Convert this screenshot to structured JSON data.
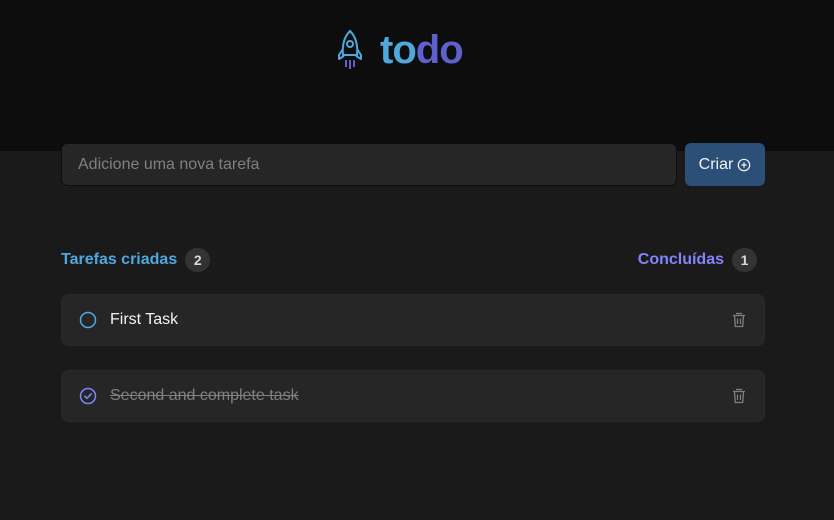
{
  "app": {
    "logo_part1": "to",
    "logo_part2": "do",
    "colors": {
      "brand_blue": "#4ea8de",
      "brand_purple": "#5e60ce",
      "purple_light": "#8284fa",
      "button": "#2b4f76"
    }
  },
  "new_task": {
    "placeholder": "Adicione uma nova tarefa",
    "value": "",
    "create_label": "Criar",
    "create_icon": "plus-circle-icon"
  },
  "counters": {
    "created_label": "Tarefas criadas",
    "created_count": "2",
    "done_label": "Concluídas",
    "done_count": "1"
  },
  "tasks": [
    {
      "text": "First Task",
      "completed": false,
      "check_icon": "circle-icon",
      "delete_icon": "trash-icon"
    },
    {
      "text": "Second and complete task",
      "completed": true,
      "check_icon": "check-circle-icon",
      "delete_icon": "trash-icon"
    }
  ]
}
